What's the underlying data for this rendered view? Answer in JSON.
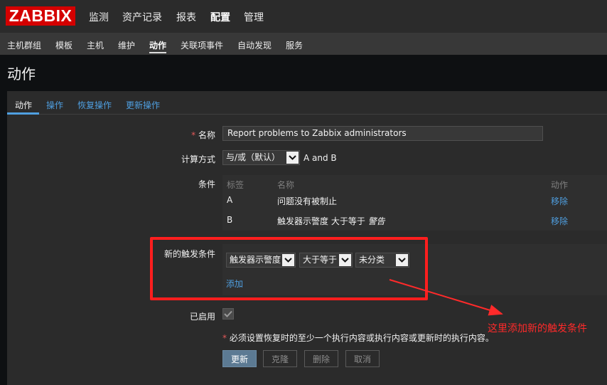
{
  "app": {
    "logo": "ZABBIX",
    "top_nav": [
      "监测",
      "资产记录",
      "报表",
      "配置",
      "管理"
    ],
    "top_nav_active": "配置",
    "sub_nav": [
      "主机群组",
      "模板",
      "主机",
      "维护",
      "动作",
      "关联项事件",
      "自动发现",
      "服务"
    ],
    "sub_nav_active": "动作"
  },
  "page": {
    "title": "动作"
  },
  "tabs": [
    "动作",
    "操作",
    "恢复操作",
    "更新操作"
  ],
  "form": {
    "name_label": "名称",
    "required_mark": "*",
    "name_value": "Report problems to Zabbix administrators",
    "calc_label": "计算方式",
    "calc_value": "与/或（默认）",
    "calc_expr": "A and B",
    "conditions_label": "条件",
    "conditions": {
      "headers": [
        "标签",
        "名称",
        "动作"
      ],
      "rows": [
        {
          "tag": "A",
          "name": "问题没有被制止",
          "name_suffix": "",
          "action": "移除"
        },
        {
          "tag": "B",
          "name": "触发器示警度 大于等于 ",
          "name_suffix": "警告",
          "action": "移除"
        }
      ]
    },
    "new_condition_label": "新的触发条件",
    "new_condition": {
      "type_value": "触发器示警度",
      "operator_value": "大于等于",
      "severity_value": "未分类",
      "add_link": "添加"
    },
    "enabled_label": "已启用",
    "enabled": true,
    "note": "必须设置恢复时的至少一个执行内容或执行内容或更新时的执行内容。",
    "buttons": {
      "update": "更新",
      "clone": "克隆",
      "delete": "删除",
      "cancel": "取消"
    }
  },
  "annotation": {
    "text": "这里添加新的触发条件",
    "color": "#ff2a2a"
  },
  "colors": {
    "brand": "#d40000",
    "link": "#4f9fe0",
    "annotation": "#ff2a2a"
  }
}
